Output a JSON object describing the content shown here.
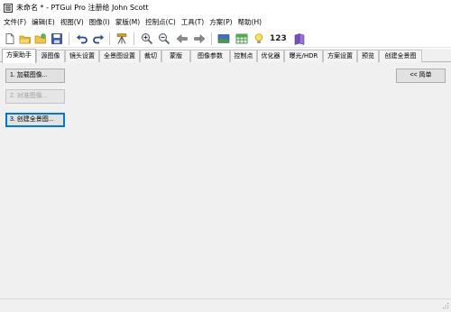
{
  "window": {
    "title": "未命名 * - PTGui Pro 注册给 John Scott",
    "app_icon": "ptgui-app-icon"
  },
  "menu": {
    "items": [
      {
        "label": "文件(F)"
      },
      {
        "label": "编辑(E)"
      },
      {
        "label": "视图(V)"
      },
      {
        "label": "图像(I)"
      },
      {
        "label": "蒙版(M)"
      },
      {
        "label": "控制点(C)"
      },
      {
        "label": "工具(T)"
      },
      {
        "label": "方案(P)"
      },
      {
        "label": "帮助(H)"
      }
    ]
  },
  "toolbar": {
    "icons": [
      "new-document-icon",
      "open-folder-icon",
      "open-recent-icon",
      "save-icon",
      "undo-icon",
      "redo-icon",
      "tripod-icon",
      "zoom-in-icon",
      "zoom-out-icon",
      "back-arrow-icon",
      "forward-arrow-icon",
      "panorama-editor-icon",
      "table-icon",
      "lightbulb-icon",
      "numbers-icon",
      "book-icon"
    ],
    "numbers_label": "123"
  },
  "tabs": {
    "items": [
      {
        "label": "方案助手",
        "active": true
      },
      {
        "label": "源图像"
      },
      {
        "label": "镜头设置"
      },
      {
        "label": "全景图设置"
      },
      {
        "label": "裁切"
      },
      {
        "label": "蒙版"
      },
      {
        "label": "图像参数"
      },
      {
        "label": "控制点"
      },
      {
        "label": "优化器"
      },
      {
        "label": "曝光/HDR"
      },
      {
        "label": "方案设置"
      },
      {
        "label": "预览"
      },
      {
        "label": "创建全景图"
      }
    ]
  },
  "assistant": {
    "load_images": "1. 加载图像...",
    "align_images": "2. 对准图像...",
    "create_panorama": "3. 创建全景图...",
    "simple_button": "<< 简单"
  },
  "colors": {
    "tab_bg": "#f3f3f3",
    "content_bg": "#f0f0f0",
    "default_button_border": "#0078d7",
    "disabled_text": "#a0a0a0"
  }
}
